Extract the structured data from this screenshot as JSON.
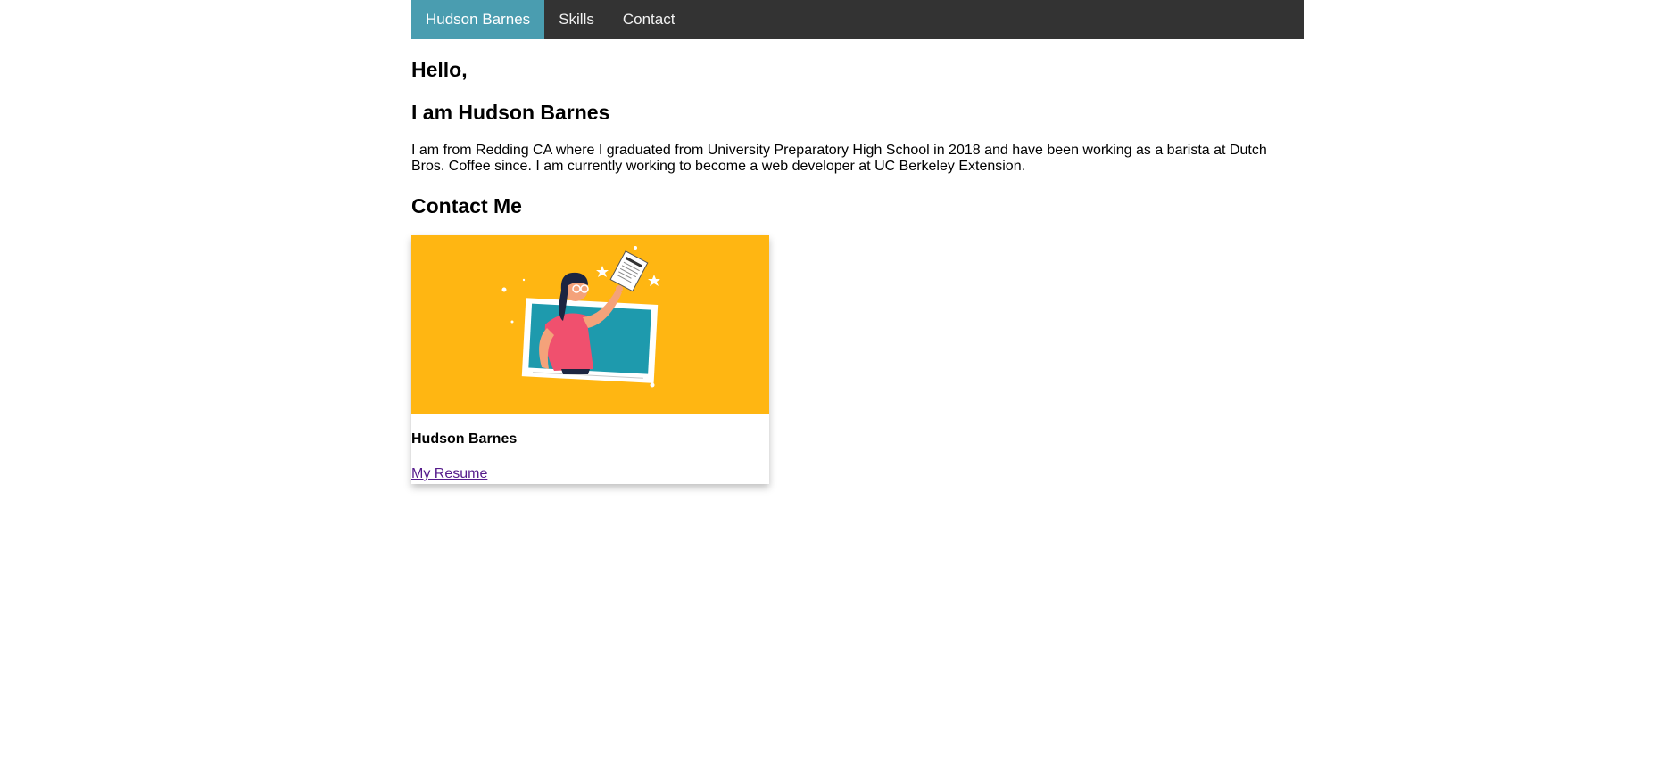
{
  "nav": {
    "items": [
      {
        "label": "Hudson Barnes",
        "active": true
      },
      {
        "label": "Skills",
        "active": false
      },
      {
        "label": "Contact",
        "active": false
      }
    ],
    "background_color": "#333333",
    "active_color": "#4a9db0"
  },
  "hero": {
    "greeting": "Hello,",
    "intro": "I am Hudson Barnes",
    "bio": "I am from Redding CA where I graduated from University Preparatory High School in 2018 and have been working as a barista at Dutch Bros. Coffee since. I am currently working to become a web developer at UC Berkeley Extension."
  },
  "contact": {
    "heading": "Contact Me",
    "card": {
      "illustration_icon": "resume-illustration",
      "name": "Hudson Barnes",
      "link_label": "My Resume",
      "image_background": "#ffb612"
    }
  }
}
